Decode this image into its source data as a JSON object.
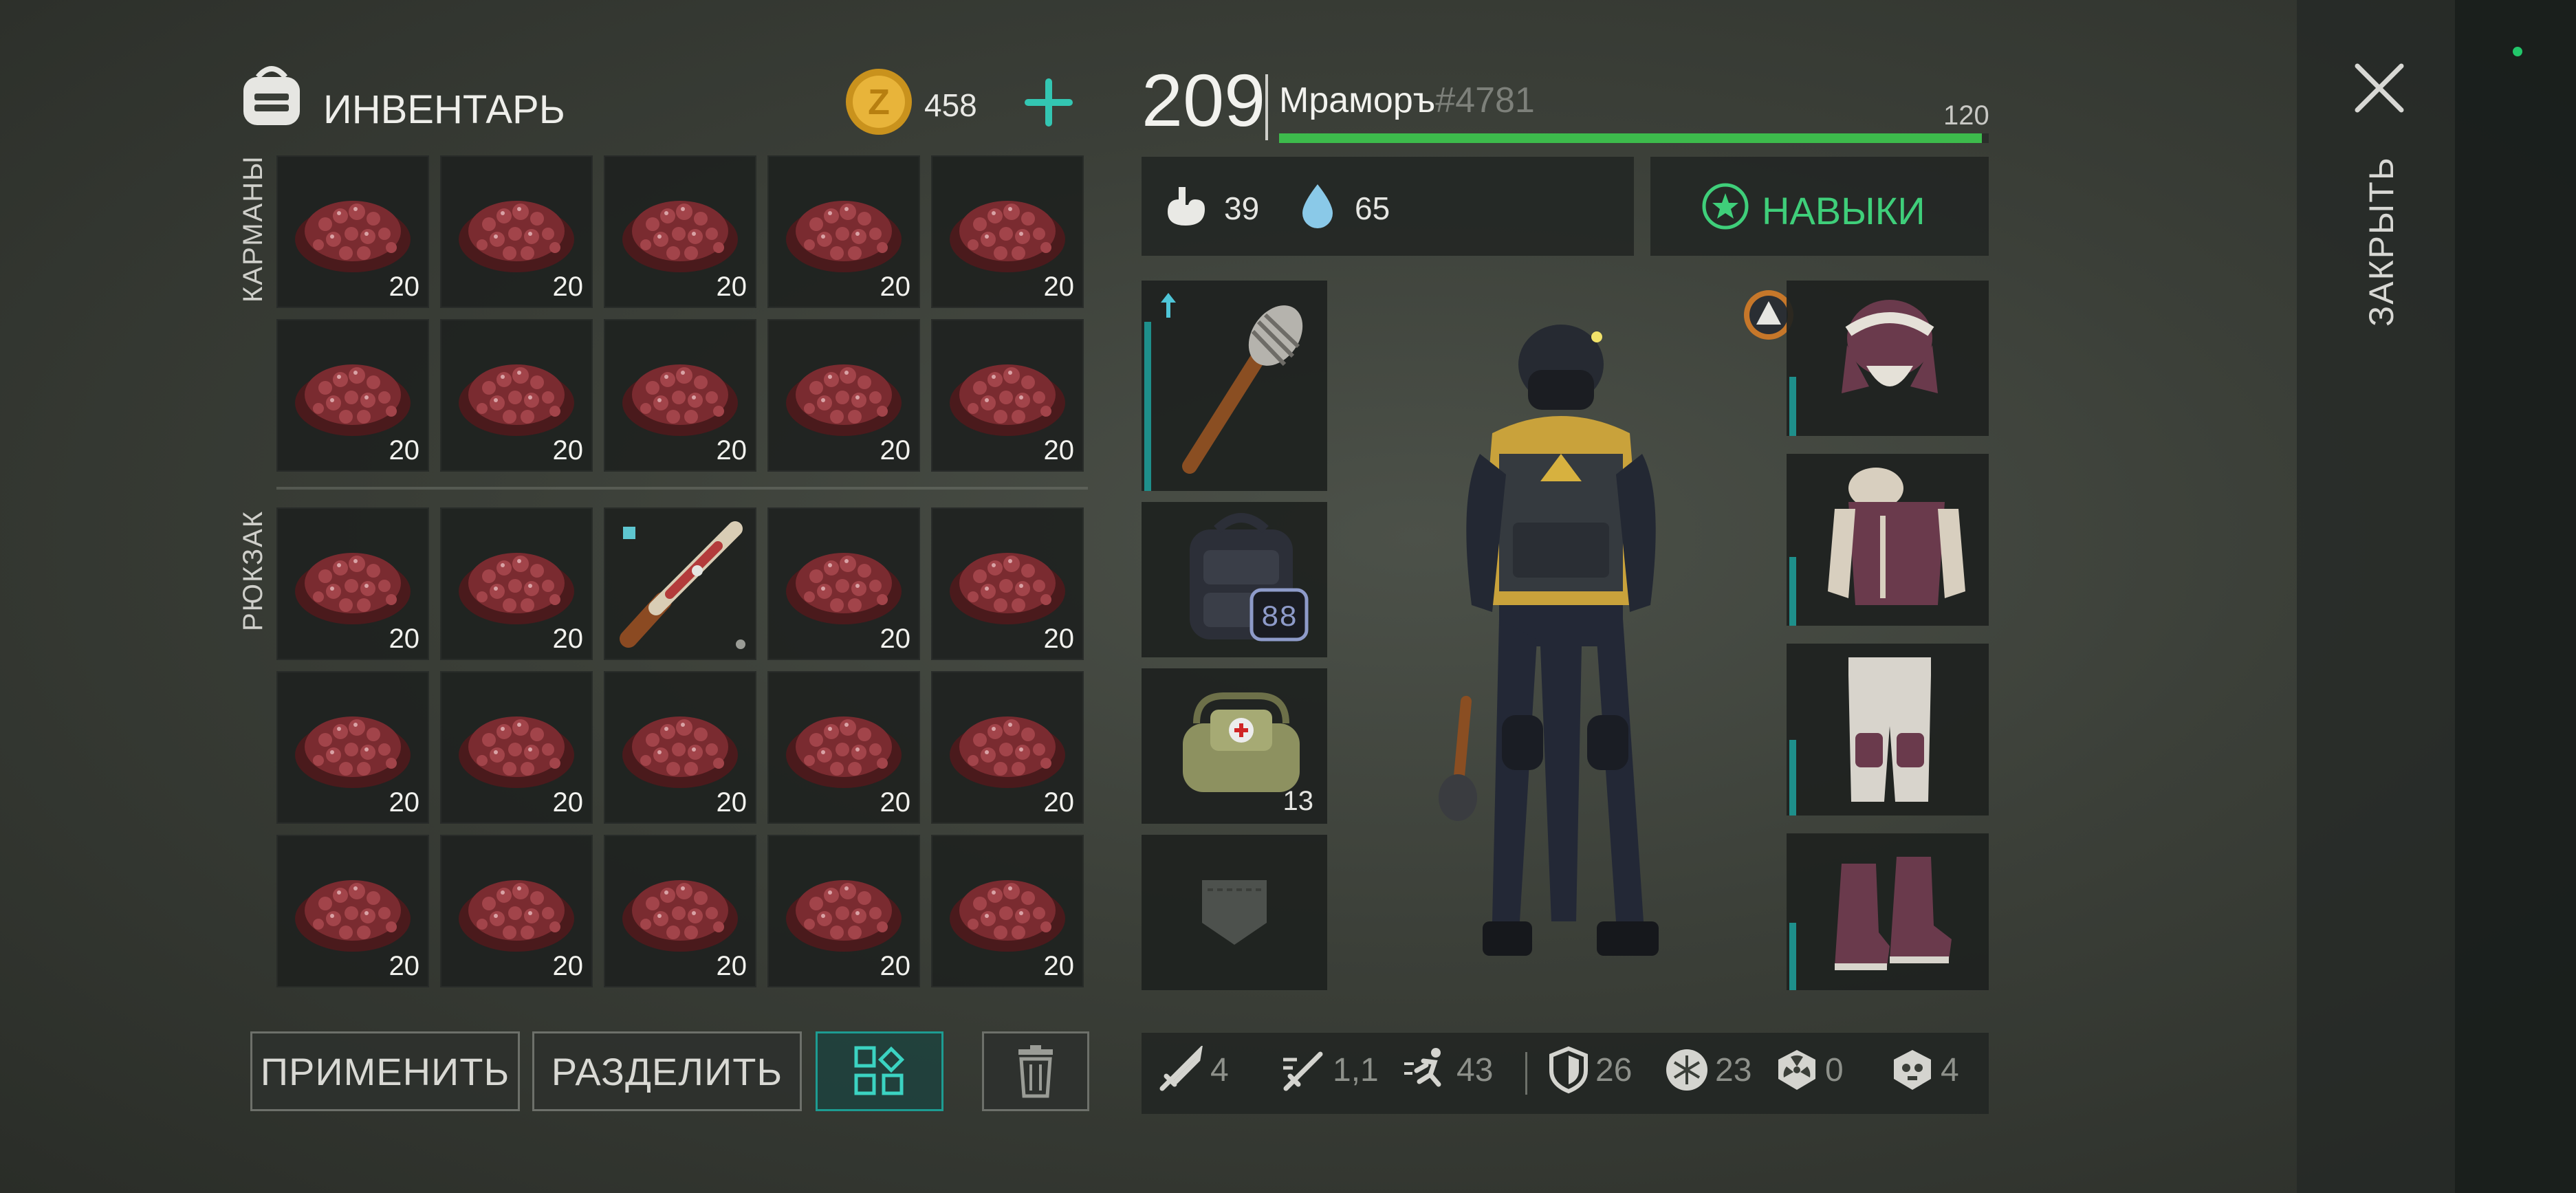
{
  "header": {
    "inventory_title": "ИНВЕНТАРЬ",
    "coins": "458",
    "level": "209",
    "player_name": "Мраморъ",
    "player_tag": "#4781",
    "xp_max_label": "120",
    "xp_progress": 0.99
  },
  "sections": {
    "pockets_label": "КАРМАНЫ",
    "backpack_label": "РЮКЗАК"
  },
  "pockets": [
    {
      "item": "berries",
      "count": "20"
    },
    {
      "item": "berries",
      "count": "20"
    },
    {
      "item": "berries",
      "count": "20"
    },
    {
      "item": "berries",
      "count": "20"
    },
    {
      "item": "berries",
      "count": "20"
    },
    {
      "item": "berries",
      "count": "20"
    },
    {
      "item": "berries",
      "count": "20"
    },
    {
      "item": "berries",
      "count": "20"
    },
    {
      "item": "berries",
      "count": "20"
    },
    {
      "item": "berries",
      "count": "20"
    }
  ],
  "backpack": [
    {
      "item": "berries",
      "count": "20"
    },
    {
      "item": "berries",
      "count": "20"
    },
    {
      "item": "shotgun",
      "count": ""
    },
    {
      "item": "berries",
      "count": "20"
    },
    {
      "item": "berries",
      "count": "20"
    },
    {
      "item": "berries",
      "count": "20"
    },
    {
      "item": "berries",
      "count": "20"
    },
    {
      "item": "berries",
      "count": "20"
    },
    {
      "item": "berries",
      "count": "20"
    },
    {
      "item": "berries",
      "count": "20"
    },
    {
      "item": "berries",
      "count": "20"
    },
    {
      "item": "berries",
      "count": "20"
    },
    {
      "item": "berries",
      "count": "20"
    },
    {
      "item": "berries",
      "count": "20"
    },
    {
      "item": "berries",
      "count": "20"
    }
  ],
  "vitals": {
    "hunger": "39",
    "thirst": "65"
  },
  "skills_label": "НАВЫКИ",
  "equipment_left": {
    "weapon": "club-icon",
    "backpack_size": "88",
    "bag_count": "13",
    "pocket": "empty-pocket-icon"
  },
  "equipment_right": [
    "hat-icon",
    "armor-icon",
    "pants-icon",
    "boots-icon"
  ],
  "actions": {
    "use_label": "ПРИМЕНИТЬ",
    "split_label": "РАЗДЕЛИТЬ"
  },
  "stats": {
    "damage": "4",
    "attack_speed": "1,1",
    "speed": "43",
    "armor": "26",
    "cold": "23",
    "radiation": "0",
    "toxic": "4"
  },
  "close_label": "ЗАКРЫТЬ",
  "colors": {
    "accent": "#3fcf7a",
    "teal": "#1e8f8b",
    "xp_bar": "#3dbb4c"
  }
}
